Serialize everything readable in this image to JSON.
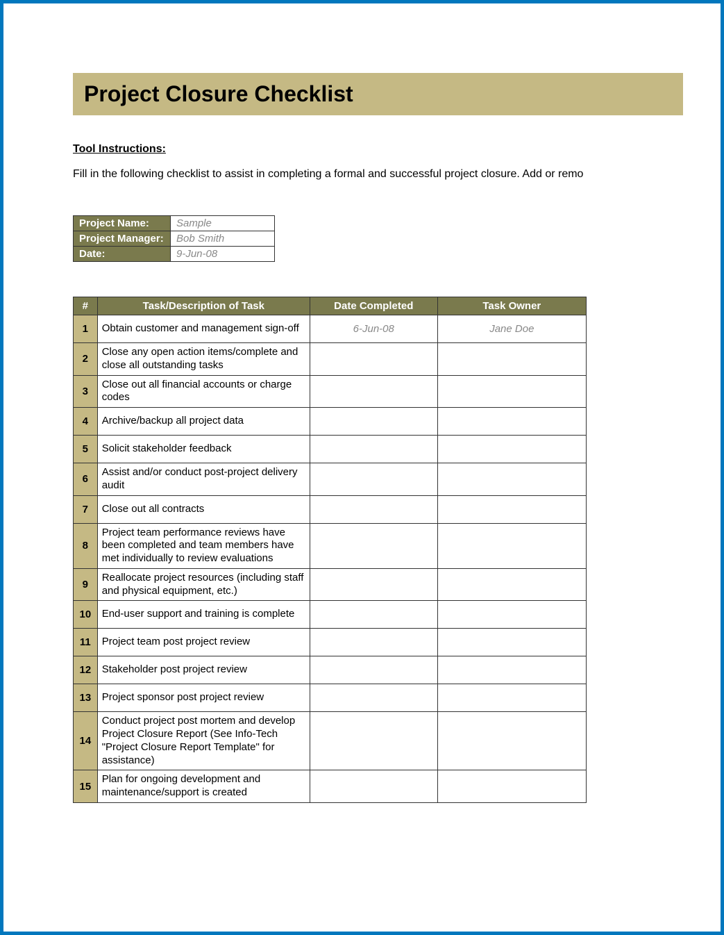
{
  "title": "Project Closure Checklist",
  "instructions": {
    "heading": "Tool Instructions:",
    "text": "Fill in the following checklist to assist in completing a formal and successful project closure. Add or remo"
  },
  "meta": {
    "labels": {
      "project_name": "Project Name:",
      "project_manager": "Project Manager:",
      "date": "Date:"
    },
    "values": {
      "project_name": "Sample",
      "project_manager": "Bob Smith",
      "date": "9-Jun-08"
    }
  },
  "checklist": {
    "headers": {
      "num": "#",
      "task": "Task/Description of Task",
      "date": "Date Completed",
      "owner": "Task Owner"
    },
    "rows": [
      {
        "num": "1",
        "task": "Obtain customer and management sign-off",
        "date": "6-Jun-08",
        "owner": "Jane Doe"
      },
      {
        "num": "2",
        "task": "Close any open action items/complete and close all outstanding tasks",
        "date": "",
        "owner": ""
      },
      {
        "num": "3",
        "task": "Close out all financial accounts or charge codes",
        "date": "",
        "owner": ""
      },
      {
        "num": "4",
        "task": "Archive/backup all project data",
        "date": "",
        "owner": ""
      },
      {
        "num": "5",
        "task": "Solicit stakeholder feedback",
        "date": "",
        "owner": ""
      },
      {
        "num": "6",
        "task": "Assist and/or conduct post-project delivery audit",
        "date": "",
        "owner": ""
      },
      {
        "num": "7",
        "task": "Close out all contracts",
        "date": "",
        "owner": ""
      },
      {
        "num": "8",
        "task": "Project team performance reviews have been completed and team members have met individually to review evaluations",
        "date": "",
        "owner": ""
      },
      {
        "num": "9",
        "task": "Reallocate project resources (including staff and physical equipment, etc.)",
        "date": "",
        "owner": ""
      },
      {
        "num": "10",
        "task": "End-user support and training is complete",
        "date": "",
        "owner": ""
      },
      {
        "num": "11",
        "task": "Project team post project review",
        "date": "",
        "owner": ""
      },
      {
        "num": "12",
        "task": "Stakeholder post project review",
        "date": "",
        "owner": ""
      },
      {
        "num": "13",
        "task": "Project sponsor post project review",
        "date": "",
        "owner": ""
      },
      {
        "num": "14",
        "task": "Conduct project post mortem and develop Project Closure Report (See Info-Tech \"Project Closure Report Template\" for assistance)",
        "date": "",
        "owner": ""
      },
      {
        "num": "15",
        "task": "Plan for ongoing development and maintenance/support is created",
        "date": "",
        "owner": ""
      }
    ]
  }
}
